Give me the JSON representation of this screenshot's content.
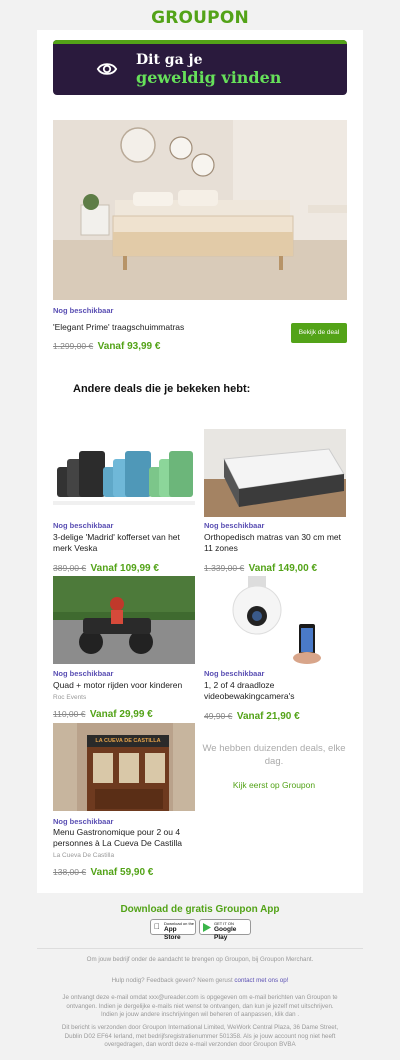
{
  "logo": "GROUPON",
  "banner": {
    "line1": "Dit ga je",
    "line2": "geweldig vinden"
  },
  "hero": {
    "status": "Nog beschikbaar",
    "title": "'Elegant Prime' traagschuimmatras",
    "old_price": "1.299,00 €",
    "new_price": "Vanaf 93,99 €",
    "button": "Bekijk de deal"
  },
  "section_title": "Andere deals die je bekeken hebt:",
  "deals": [
    {
      "status": "Nog beschikbaar",
      "title": "3-delige 'Madrid' kofferset van het merk Veska",
      "merchant": "",
      "old_price": "389,00 €",
      "new_price": "Vanaf 109,99 €"
    },
    {
      "status": "Nog beschikbaar",
      "title": "Orthopedisch matras van 30 cm met 11 zones",
      "merchant": "",
      "old_price": "1.339,00 €",
      "new_price": "Vanaf 149,00 €"
    },
    {
      "status": "Nog beschikbaar",
      "title": "Quad + motor rijden voor kinderen",
      "merchant": "Roc Events",
      "old_price": "110,00 €",
      "new_price": "Vanaf 29,99 €"
    },
    {
      "status": "Nog beschikbaar",
      "title": "1, 2 of 4 draadloze videobewakingcamera's",
      "merchant": "",
      "old_price": "49,90 €",
      "new_price": "Vanaf 21,90 €"
    },
    {
      "status": "Nog beschikbaar",
      "title": "Menu Gastronomique pour 2 ou 4 personnes à La Cueva De Castilla",
      "merchant": "La Cueva De Castilla",
      "old_price": "138,00 €",
      "new_price": "Vanaf 59,90 €"
    }
  ],
  "restaurant_sign": "LA CUEVA DE CASTILLA",
  "promo": {
    "text": "We hebben duizenden deals, elke dag.",
    "link": "Kijk eerst op Groupon"
  },
  "app": {
    "title": "Download de gratis Groupon App",
    "appstore_small": "Download on the",
    "appstore": "App Store",
    "googleplay_small": "GET IT ON",
    "googleplay": "Google Play"
  },
  "footer": {
    "merchant": "Om jouw bedrijf onder de aandacht te brengen op Groupon, bij Groupon Merchant.",
    "help": "Hulp nodig? Feedback geven? Neem gerust",
    "contact": "contact met ons op!",
    "legal1": "Je ontvangt deze e-mail omdat xxx@ureader.com is opgegeven om e-mail berichten van Groupon te ontvangen. Indien je dergelijke e-mails niet wenst te ontvangen, dan kun je jezelf met uitschrijven. Indien je jouw andere inschrijvingen wil beheren of aanpassen, klik dan .",
    "legal2": "Dit bericht is verzonden door Groupon International Limited, WeWork Central Plaza, 36 Dame Street, Dublin D02 EF64 Ierland, met bedrijfsregistratienummer 501358. Als je jouw account nog niet heeft overgedragen, dan wordt deze e-mail verzonden door Groupon BVBA"
  },
  "colors": {
    "brand_green": "#53a318",
    "banner_bg": "#2a1a3d",
    "status_purple": "#5a4fb3"
  }
}
